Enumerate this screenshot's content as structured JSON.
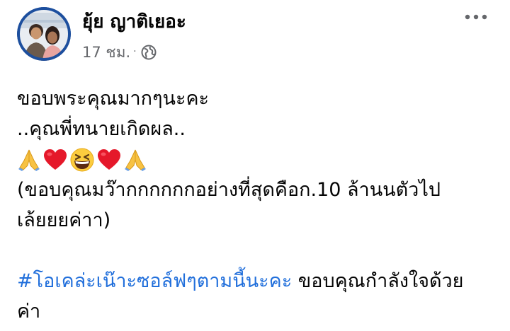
{
  "post": {
    "author": "ยุ้ย ญาติเยอะ",
    "time": "17 ชม.",
    "separator": "·",
    "privacy_icon": "globe-icon",
    "more_icon": "more-options-icon",
    "lines": [
      "ขอบพระคุณมากๆนะคะ",
      "..คุณพี่ทนายเกิดผล..",
      "(ขอบคุณมว๊ากกกกกกอย่างที่สุดคือก.10 ล้านนตัวไป",
      "เล้ยยยค่าา)"
    ],
    "emojis": [
      "folded-hands-icon",
      "red-heart-icon",
      "grinning-squinting-face-icon",
      "red-heart-icon",
      "folded-hands-icon"
    ],
    "hashtag": "#โอเคล่ะเน๊าะซอล์ฟๆตามนี้นะคะ",
    "hashtag_tail": " ขอบคุณกำลังใจด้วย",
    "last_line": "ค่า"
  },
  "colors": {
    "link": "#216fdb",
    "secondary_text": "#65676b",
    "primary_text": "#050505"
  }
}
